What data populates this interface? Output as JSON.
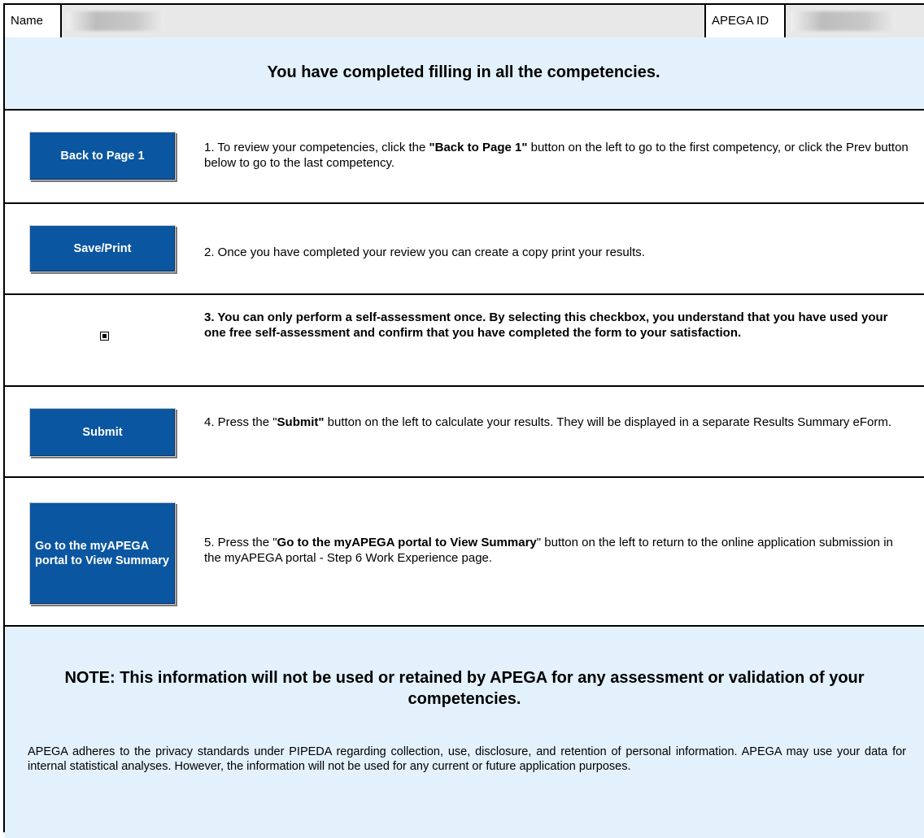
{
  "header": {
    "name_label": "Name",
    "apega_id_label": "APEGA ID"
  },
  "title": "You have completed filling in all the competencies.",
  "steps": [
    {
      "button": "Back to Page 1",
      "desc_pre": "1.  To review your competencies, click the ",
      "desc_bold": "\"Back to Page 1\"",
      "desc_post": " button on the left to go to the first competency, or click the Prev button below to go to the last competency."
    },
    {
      "button": "Save/Print",
      "desc": "2.  Once you have completed your review you can create a copy print your results."
    },
    {
      "checkbox_checked": true,
      "desc": "3.  You can only perform a self-assessment once. By selecting this checkbox, you understand that you have used your one free self-assessment and confirm that you have completed the form to your satisfaction."
    },
    {
      "button": "Submit",
      "desc_pre": "4.  Press the \"",
      "desc_bold": "Submit\"",
      "desc_post": " button on the left to calculate your results. They will be displayed in a separate Results Summary eForm."
    },
    {
      "button": "Go to the myAPEGA portal to View Summary",
      "desc_pre": "5.  Press the \"",
      "desc_bold": "Go to the myAPEGA portal to View Summary",
      "desc_post": "\" button on the left to return to the online application submission in the myAPEGA portal - Step 6 Work Experience page."
    }
  ],
  "note": {
    "title": "NOTE:  This information will not be used or retained by APEGA for any assessment or validation of your competencies.",
    "body": "APEGA adheres to the privacy standards under PIPEDA regarding collection, use, disclosure, and retention of personal information. APEGA may use your data for internal statistical analyses. However, the information will not be used for any current or future application purposes."
  },
  "colors": {
    "button_blue": "#0b56a0",
    "band_blue": "#e3f1fc"
  }
}
